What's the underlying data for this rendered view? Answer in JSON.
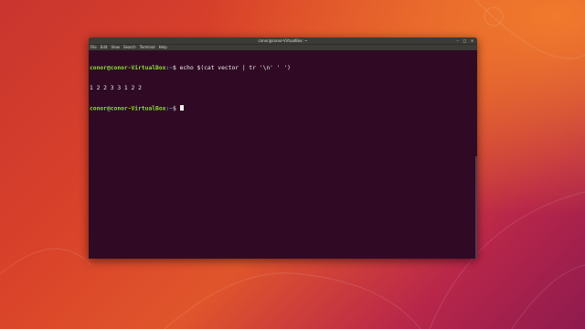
{
  "window": {
    "title": "conor@conor-VirtualBox: ~"
  },
  "menubar": {
    "items": [
      {
        "label": "File"
      },
      {
        "label": "Edit"
      },
      {
        "label": "View"
      },
      {
        "label": "Search"
      },
      {
        "label": "Terminal"
      },
      {
        "label": "Help"
      }
    ]
  },
  "controls": {
    "minimize": "–",
    "maximize": "□",
    "close": "✕"
  },
  "terminal": {
    "lines": [
      {
        "user": "conor@conor-VirtualBox",
        "path": ":~",
        "symbol": "$ ",
        "command": "echo $(cat vector | tr '\\n' ' ')"
      },
      {
        "output": "1 2 2 3 3 1 2 2"
      },
      {
        "user": "conor@conor-VirtualBox",
        "path": ":~",
        "symbol": "$ ",
        "command": ""
      }
    ]
  },
  "colors": {
    "terminal_bg": "#300a24",
    "prompt_user": "#8ae234",
    "prompt_path": "#729fcf",
    "titlebar": "#3c3b37"
  }
}
